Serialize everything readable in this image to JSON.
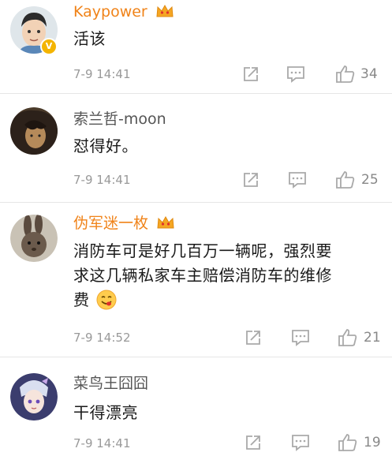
{
  "colors": {
    "vip_name": "#f08319",
    "plain_name": "#555555",
    "meta": "#999999",
    "icon": "#a9a9a9"
  },
  "comments": [
    {
      "username": "Kaypower",
      "vip": true,
      "text_lines": [
        "活该"
      ],
      "time": "7-9 14:41",
      "likes": "34"
    },
    {
      "username": "索兰哲-moon",
      "vip": false,
      "text_lines": [
        "怼得好。"
      ],
      "time": "7-9 14:41",
      "likes": "25"
    },
    {
      "username": "伪军迷一枚",
      "vip": true,
      "text_lines": [
        "消防车可是好几百万一辆呢，强烈要",
        "求这几辆私家车主赔偿消防车的维修",
        "费"
      ],
      "emoji": "yum-face-emoji",
      "time": "7-9 14:52",
      "likes": "21"
    },
    {
      "username": "菜鸟王囧囧",
      "vip": false,
      "text_lines": [
        "干得漂亮"
      ],
      "time": "7-9 14:41",
      "likes": "19"
    }
  ],
  "icons": {
    "share": "share-icon",
    "comment": "comment-icon",
    "like": "like-icon",
    "vip": "crown-icon",
    "verified": "verified-icon"
  }
}
